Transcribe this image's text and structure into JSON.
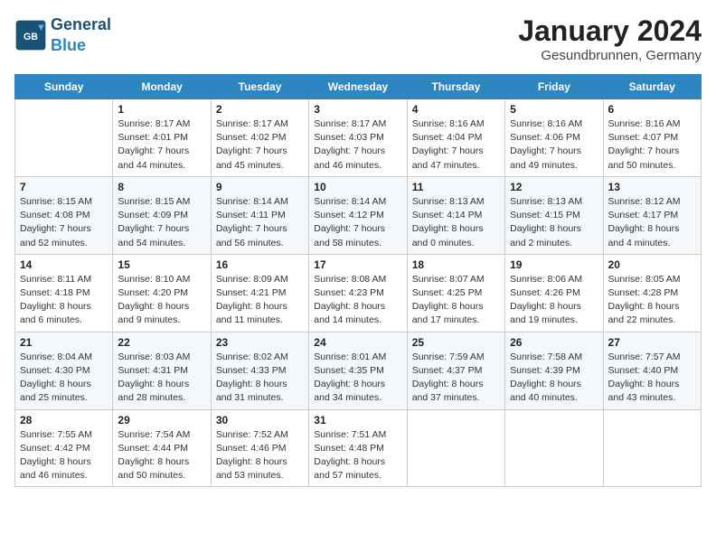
{
  "header": {
    "logo_general": "General",
    "logo_blue": "Blue",
    "title": "January 2024",
    "subtitle": "Gesundbrunnen, Germany"
  },
  "days_of_week": [
    "Sunday",
    "Monday",
    "Tuesday",
    "Wednesday",
    "Thursday",
    "Friday",
    "Saturday"
  ],
  "weeks": [
    [
      {
        "num": "",
        "sunrise": "",
        "sunset": "",
        "daylight": ""
      },
      {
        "num": "1",
        "sunrise": "Sunrise: 8:17 AM",
        "sunset": "Sunset: 4:01 PM",
        "daylight": "Daylight: 7 hours and 44 minutes."
      },
      {
        "num": "2",
        "sunrise": "Sunrise: 8:17 AM",
        "sunset": "Sunset: 4:02 PM",
        "daylight": "Daylight: 7 hours and 45 minutes."
      },
      {
        "num": "3",
        "sunrise": "Sunrise: 8:17 AM",
        "sunset": "Sunset: 4:03 PM",
        "daylight": "Daylight: 7 hours and 46 minutes."
      },
      {
        "num": "4",
        "sunrise": "Sunrise: 8:16 AM",
        "sunset": "Sunset: 4:04 PM",
        "daylight": "Daylight: 7 hours and 47 minutes."
      },
      {
        "num": "5",
        "sunrise": "Sunrise: 8:16 AM",
        "sunset": "Sunset: 4:06 PM",
        "daylight": "Daylight: 7 hours and 49 minutes."
      },
      {
        "num": "6",
        "sunrise": "Sunrise: 8:16 AM",
        "sunset": "Sunset: 4:07 PM",
        "daylight": "Daylight: 7 hours and 50 minutes."
      }
    ],
    [
      {
        "num": "7",
        "sunrise": "Sunrise: 8:15 AM",
        "sunset": "Sunset: 4:08 PM",
        "daylight": "Daylight: 7 hours and 52 minutes."
      },
      {
        "num": "8",
        "sunrise": "Sunrise: 8:15 AM",
        "sunset": "Sunset: 4:09 PM",
        "daylight": "Daylight: 7 hours and 54 minutes."
      },
      {
        "num": "9",
        "sunrise": "Sunrise: 8:14 AM",
        "sunset": "Sunset: 4:11 PM",
        "daylight": "Daylight: 7 hours and 56 minutes."
      },
      {
        "num": "10",
        "sunrise": "Sunrise: 8:14 AM",
        "sunset": "Sunset: 4:12 PM",
        "daylight": "Daylight: 7 hours and 58 minutes."
      },
      {
        "num": "11",
        "sunrise": "Sunrise: 8:13 AM",
        "sunset": "Sunset: 4:14 PM",
        "daylight": "Daylight: 8 hours and 0 minutes."
      },
      {
        "num": "12",
        "sunrise": "Sunrise: 8:13 AM",
        "sunset": "Sunset: 4:15 PM",
        "daylight": "Daylight: 8 hours and 2 minutes."
      },
      {
        "num": "13",
        "sunrise": "Sunrise: 8:12 AM",
        "sunset": "Sunset: 4:17 PM",
        "daylight": "Daylight: 8 hours and 4 minutes."
      }
    ],
    [
      {
        "num": "14",
        "sunrise": "Sunrise: 8:11 AM",
        "sunset": "Sunset: 4:18 PM",
        "daylight": "Daylight: 8 hours and 6 minutes."
      },
      {
        "num": "15",
        "sunrise": "Sunrise: 8:10 AM",
        "sunset": "Sunset: 4:20 PM",
        "daylight": "Daylight: 8 hours and 9 minutes."
      },
      {
        "num": "16",
        "sunrise": "Sunrise: 8:09 AM",
        "sunset": "Sunset: 4:21 PM",
        "daylight": "Daylight: 8 hours and 11 minutes."
      },
      {
        "num": "17",
        "sunrise": "Sunrise: 8:08 AM",
        "sunset": "Sunset: 4:23 PM",
        "daylight": "Daylight: 8 hours and 14 minutes."
      },
      {
        "num": "18",
        "sunrise": "Sunrise: 8:07 AM",
        "sunset": "Sunset: 4:25 PM",
        "daylight": "Daylight: 8 hours and 17 minutes."
      },
      {
        "num": "19",
        "sunrise": "Sunrise: 8:06 AM",
        "sunset": "Sunset: 4:26 PM",
        "daylight": "Daylight: 8 hours and 19 minutes."
      },
      {
        "num": "20",
        "sunrise": "Sunrise: 8:05 AM",
        "sunset": "Sunset: 4:28 PM",
        "daylight": "Daylight: 8 hours and 22 minutes."
      }
    ],
    [
      {
        "num": "21",
        "sunrise": "Sunrise: 8:04 AM",
        "sunset": "Sunset: 4:30 PM",
        "daylight": "Daylight: 8 hours and 25 minutes."
      },
      {
        "num": "22",
        "sunrise": "Sunrise: 8:03 AM",
        "sunset": "Sunset: 4:31 PM",
        "daylight": "Daylight: 8 hours and 28 minutes."
      },
      {
        "num": "23",
        "sunrise": "Sunrise: 8:02 AM",
        "sunset": "Sunset: 4:33 PM",
        "daylight": "Daylight: 8 hours and 31 minutes."
      },
      {
        "num": "24",
        "sunrise": "Sunrise: 8:01 AM",
        "sunset": "Sunset: 4:35 PM",
        "daylight": "Daylight: 8 hours and 34 minutes."
      },
      {
        "num": "25",
        "sunrise": "Sunrise: 7:59 AM",
        "sunset": "Sunset: 4:37 PM",
        "daylight": "Daylight: 8 hours and 37 minutes."
      },
      {
        "num": "26",
        "sunrise": "Sunrise: 7:58 AM",
        "sunset": "Sunset: 4:39 PM",
        "daylight": "Daylight: 8 hours and 40 minutes."
      },
      {
        "num": "27",
        "sunrise": "Sunrise: 7:57 AM",
        "sunset": "Sunset: 4:40 PM",
        "daylight": "Daylight: 8 hours and 43 minutes."
      }
    ],
    [
      {
        "num": "28",
        "sunrise": "Sunrise: 7:55 AM",
        "sunset": "Sunset: 4:42 PM",
        "daylight": "Daylight: 8 hours and 46 minutes."
      },
      {
        "num": "29",
        "sunrise": "Sunrise: 7:54 AM",
        "sunset": "Sunset: 4:44 PM",
        "daylight": "Daylight: 8 hours and 50 minutes."
      },
      {
        "num": "30",
        "sunrise": "Sunrise: 7:52 AM",
        "sunset": "Sunset: 4:46 PM",
        "daylight": "Daylight: 8 hours and 53 minutes."
      },
      {
        "num": "31",
        "sunrise": "Sunrise: 7:51 AM",
        "sunset": "Sunset: 4:48 PM",
        "daylight": "Daylight: 8 hours and 57 minutes."
      },
      {
        "num": "",
        "sunrise": "",
        "sunset": "",
        "daylight": ""
      },
      {
        "num": "",
        "sunrise": "",
        "sunset": "",
        "daylight": ""
      },
      {
        "num": "",
        "sunrise": "",
        "sunset": "",
        "daylight": ""
      }
    ]
  ]
}
